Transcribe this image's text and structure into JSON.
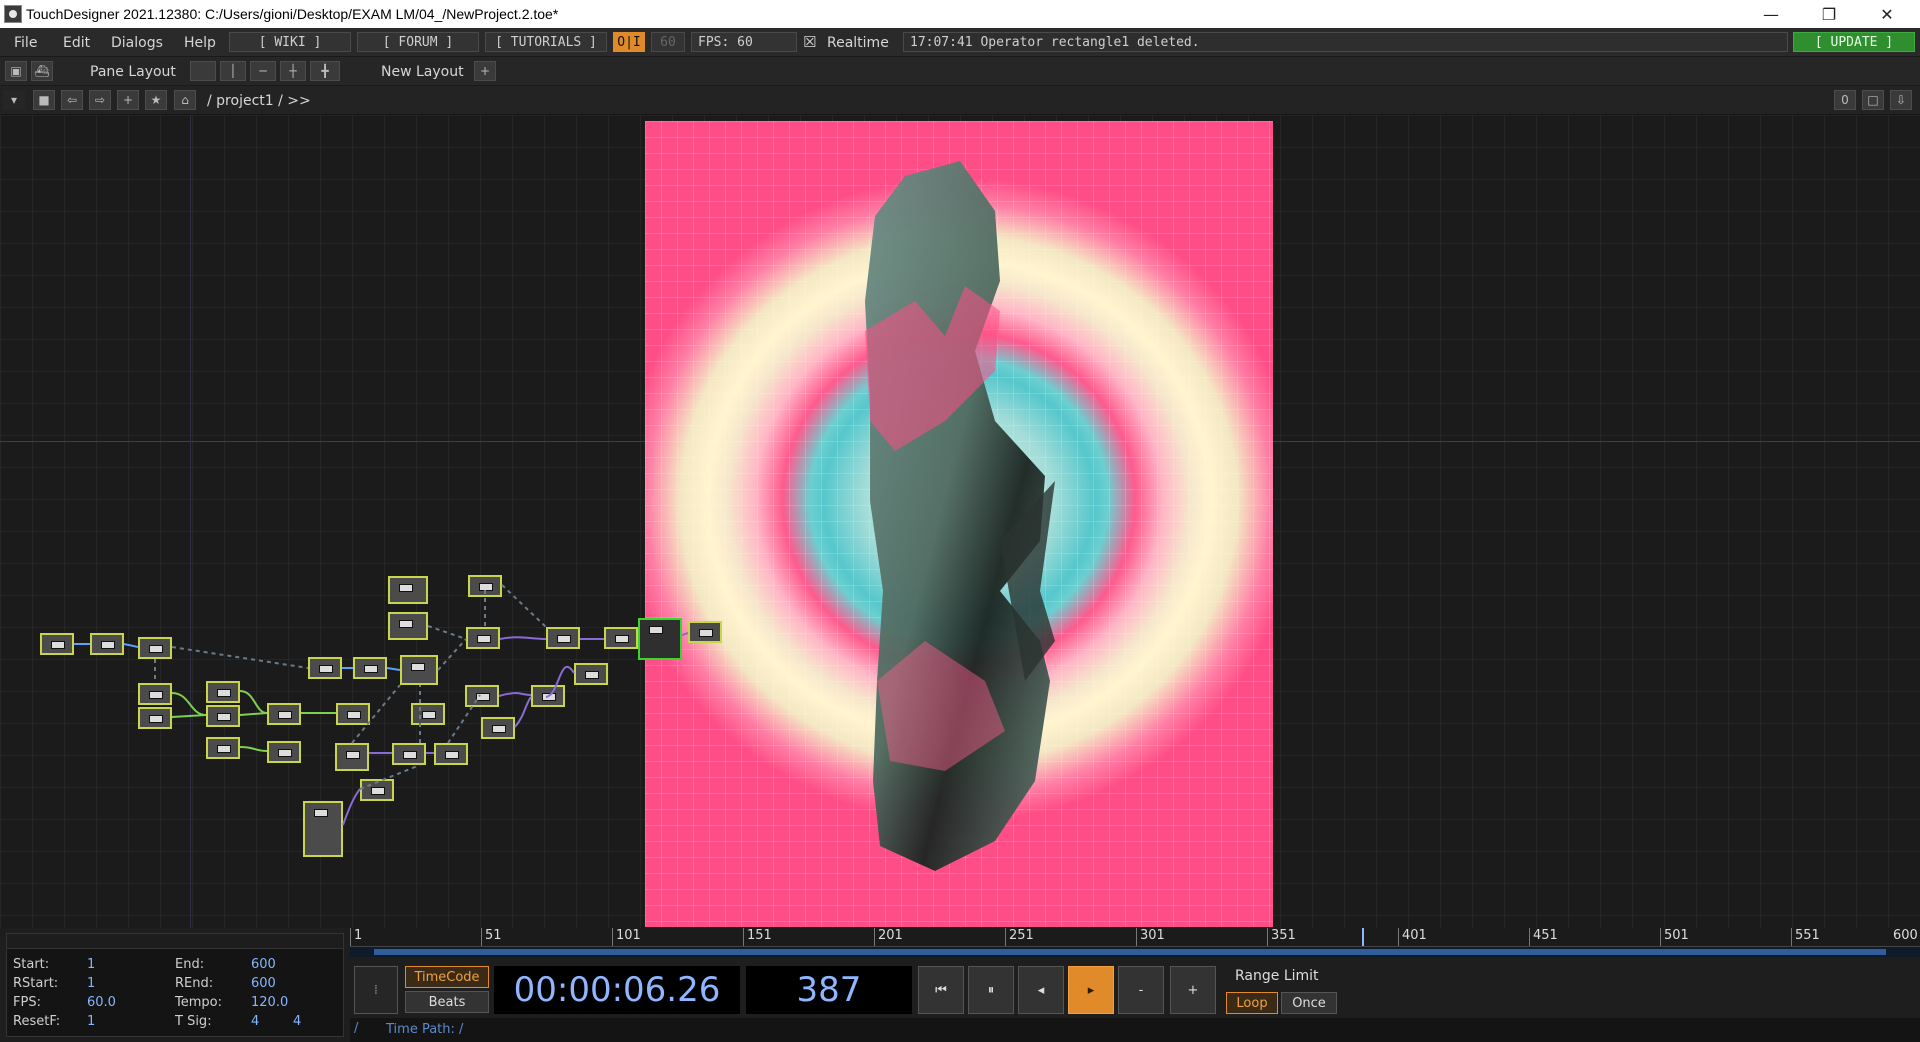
{
  "titlebar": {
    "title": "TouchDesigner 2021.12380: C:/Users/gioni/Desktop/EXAM LM/04_/NewProject.2.toe*",
    "minimize": "—",
    "restore": "❐",
    "close": "✕"
  },
  "menubar": {
    "menus": [
      "File",
      "Edit",
      "Dialogs",
      "Help"
    ],
    "wiki": "[ WIKI ]",
    "forum": "[ FORUM ]",
    "tutorials": "[ TUTORIALS ]",
    "oi": "O|I",
    "fps_limit": "60",
    "fps_label": "FPS:  60",
    "realtime_check": "☒",
    "realtime": "Realtime",
    "status": "17:07:41 Operator rectangle1 deleted.",
    "update": "[ UPDATE ]"
  },
  "toolbar2": {
    "pane_layout": "Pane Layout",
    "new_layout": "New Layout",
    "add": "+"
  },
  "pathbar": {
    "path": "/ project1 / >>",
    "right_value": "0"
  },
  "timeinfo": {
    "start_label": "Start:",
    "start": "1",
    "end_label": "End:",
    "end": "600",
    "rstart_label": "RStart:",
    "rstart": "1",
    "rend_label": "REnd:",
    "rend": "600",
    "fps_label": "FPS:",
    "fps": "60.0",
    "tempo_label": "Tempo:",
    "tempo": "120.0",
    "resetf_label": "ResetF:",
    "resetf": "1",
    "tsig_label": "T Sig:",
    "tsig_a": "4",
    "tsig_b": "4"
  },
  "timeline": {
    "ticks": [
      "1",
      "51",
      "101",
      "151",
      "201",
      "251",
      "301",
      "351",
      "401",
      "451",
      "501",
      "551",
      "600"
    ],
    "timecode_btn": "TimeCode",
    "beats_btn": "Beats",
    "timecode": "00:00:06.26",
    "frame": "387",
    "range_limit": "Range Limit",
    "loop": "Loop",
    "once": "Once",
    "minus": "-",
    "plus": "+",
    "time_path": "Time Path: /"
  },
  "colors": {
    "accent_orange": "#e08a2a",
    "update_green": "#2f8f2f",
    "node_border": "#c9d54a",
    "selected_node": "#39d62c",
    "value_blue": "#86b5ff"
  }
}
